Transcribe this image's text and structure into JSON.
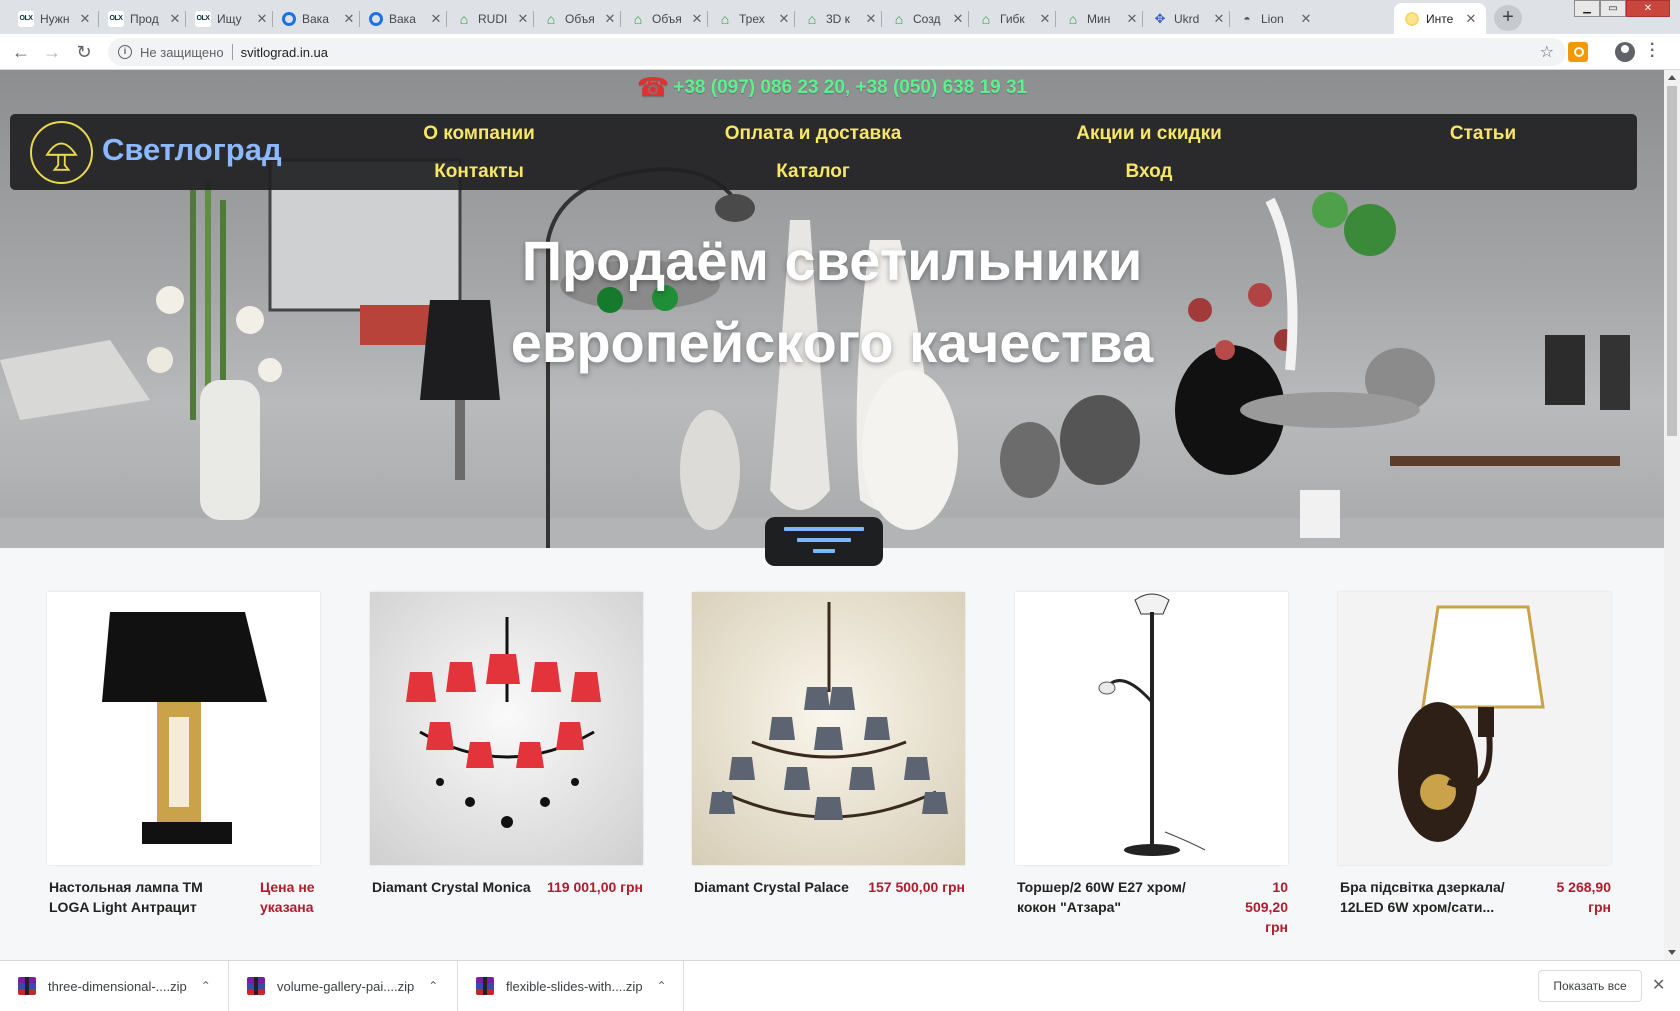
{
  "browser": {
    "tabs": [
      {
        "title": "Нужн",
        "icon": "olx-favicon-icon"
      },
      {
        "title": "Прод",
        "icon": "olx-favicon-icon"
      },
      {
        "title": "Ищу",
        "icon": "olx-favicon-icon"
      },
      {
        "title": "Вака",
        "icon": "ring-favicon-icon"
      },
      {
        "title": "Вака",
        "icon": "ring-favicon-icon"
      },
      {
        "title": "RUDI",
        "icon": "house-favicon-icon"
      },
      {
        "title": "Объя",
        "icon": "house-favicon-icon"
      },
      {
        "title": "Объя",
        "icon": "house-favicon-icon"
      },
      {
        "title": "Трех",
        "icon": "house-favicon-icon"
      },
      {
        "title": "3D к",
        "icon": "house-favicon-icon"
      },
      {
        "title": "Созд",
        "icon": "house-favicon-icon"
      },
      {
        "title": "Гибк",
        "icon": "house-favicon-icon"
      },
      {
        "title": "Мин",
        "icon": "house-favicon-icon"
      },
      {
        "title": "Ukrd",
        "icon": "puzzle-favicon-icon"
      },
      {
        "title": "Lion",
        "icon": "car-favicon-icon"
      },
      {
        "title": "Инте",
        "icon": "lamp-favicon-icon",
        "active": true
      }
    ],
    "close_glyph": "✕",
    "new_tab_glyph": "+",
    "window_controls": {
      "minimize": "▁",
      "maximize": "▭",
      "close": "✕"
    },
    "omnibox": {
      "security": "Не защищено",
      "url": "svitlograd.in.ua"
    }
  },
  "site": {
    "phone": "+38 (097) 086 23 20, +38 (050) 638 19 31",
    "brand": "Светлоград",
    "nav": [
      {
        "label": "О компании"
      },
      {
        "label": "Оплата и доставка"
      },
      {
        "label": "Акции и скидки"
      },
      {
        "label": "Статьи"
      },
      {
        "label": "Контакты"
      },
      {
        "label": "Каталог"
      },
      {
        "label": "Вход"
      }
    ],
    "headline": {
      "line1": "Продаём светильники",
      "line2": "европейского качества"
    }
  },
  "products": [
    {
      "name": "Настольная лампа ТМ LOGA Light Антрацит",
      "price": "Цена не указана"
    },
    {
      "name": "Diamant Crystal Monica",
      "price": "119 001,00 грн"
    },
    {
      "name": "Diamant Crystal Palace",
      "price": "157 500,00 грн"
    },
    {
      "name": "Торшер/2 60W E27 хром/кокон \"Атзара\"",
      "price": "10 509,20 грн"
    },
    {
      "name": "Бра підсвітка дзеркала/ 12LED 6W хром/сати...",
      "price": "5 268,90 грн"
    }
  ],
  "downloads": {
    "items": [
      {
        "name": "three-dimensional-....zip"
      },
      {
        "name": "volume-gallery-pai....zip"
      },
      {
        "name": "flexible-slides-with....zip"
      }
    ],
    "chevron": "⌃",
    "show_all": "Показать все",
    "close": "✕"
  },
  "colors": {
    "accent_nav": "#f6e768",
    "brand": "#8bb8ff",
    "phone": "#5df08e",
    "price": "#b01c2c"
  }
}
